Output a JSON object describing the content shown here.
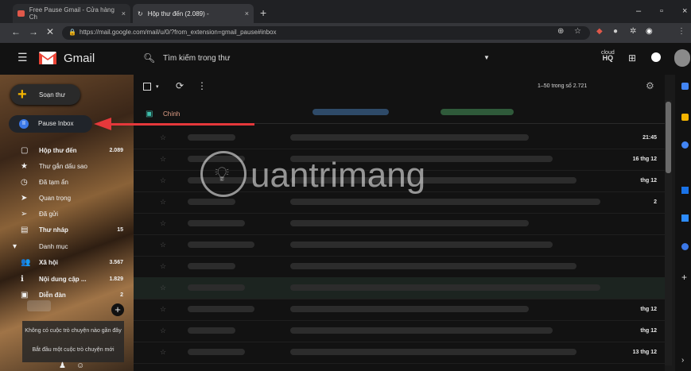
{
  "browser": {
    "tabs": [
      {
        "label": "Free Pause Gmail - Cửa hàng Ch",
        "close": "×"
      },
      {
        "label": "Hộp thư đến (2.089) -",
        "close": "×"
      }
    ],
    "new_tab": "+",
    "window_controls": [
      "–",
      "▫",
      "×"
    ],
    "url": "https://mail.google.com/mail/u/0/?from_extension=gmail_pause#inbox",
    "nav": {
      "back": "←",
      "forward": "→",
      "stop": "✕"
    }
  },
  "gmail": {
    "app_name": "Gmail",
    "search_placeholder": "Tìm kiếm trong thư",
    "hq_label": "HQ",
    "hq_top": "cloud"
  },
  "sidebar": {
    "compose": "Soạn thư",
    "pause_inbox": "Pause Inbox",
    "items": [
      {
        "label": "Hộp thư đến",
        "count": "2.089",
        "bold": true,
        "icon": "▢"
      },
      {
        "label": "Thư gắn dấu sao",
        "count": "",
        "bold": false,
        "icon": "★"
      },
      {
        "label": "Đã tạm ẩn",
        "count": "",
        "bold": false,
        "icon": "◷"
      },
      {
        "label": "Quan trọng",
        "count": "",
        "bold": false,
        "icon": "➤"
      },
      {
        "label": "Đã gửi",
        "count": "",
        "bold": false,
        "icon": "➢"
      },
      {
        "label": "Thư nháp",
        "count": "15",
        "bold": true,
        "icon": "▤"
      },
      {
        "label": "Danh mục",
        "count": "",
        "bold": false,
        "icon": "▾"
      },
      {
        "label": "Xã hội",
        "count": "3.567",
        "bold": true,
        "icon": "👥"
      },
      {
        "label": "Nội dung cập ...",
        "count": "1.829",
        "bold": true,
        "icon": "ℹ"
      },
      {
        "label": "Diễn đàn",
        "count": "2",
        "bold": true,
        "icon": "▣"
      }
    ],
    "chat_empty_1": "Không có cuộc trò chuyện nào gần đây",
    "chat_empty_2": "Bắt đầu một cuộc trò chuyện mới",
    "chat_add": "+"
  },
  "toolbar": {
    "pager": "1–50 trong số 2.721"
  },
  "tabs": {
    "primary": "Chính"
  },
  "rows": [
    {
      "date": "21:45"
    },
    {
      "date": "16 thg 12"
    },
    {
      "date": "thg 12"
    },
    {
      "date": "2"
    },
    {
      "date": ""
    },
    {
      "date": ""
    },
    {
      "date": ""
    },
    {
      "date": ""
    },
    {
      "date": "thg 12"
    },
    {
      "date": "thg 12"
    },
    {
      "date": "13 thg 12"
    }
  ],
  "watermark": "uantrimang",
  "colors": {
    "accent_red": "#e5383b",
    "pause_blue": "#3b78e7",
    "compose_plus": "#f4b400",
    "primary_tab": "#3fbfad"
  }
}
